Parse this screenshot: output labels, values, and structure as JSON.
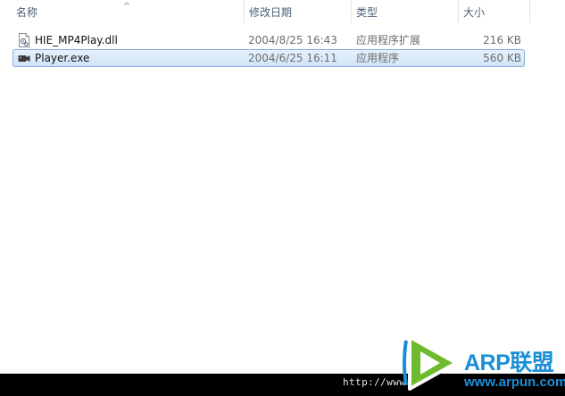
{
  "columns": [
    {
      "label": "名称"
    },
    {
      "label": "修改日期"
    },
    {
      "label": "类型"
    },
    {
      "label": "大小"
    }
  ],
  "files": [
    {
      "name": "HIE_MP4Play.dll",
      "date": "2004/8/25 16:43",
      "type": "应用程序扩展",
      "size": "216 KB",
      "icon": "dll-file-icon",
      "selected": false
    },
    {
      "name": "Player.exe",
      "date": "2004/6/25 16:11",
      "type": "应用程序",
      "size": "560 KB",
      "icon": "exe-file-icon",
      "selected": true
    }
  ],
  "status_bar": {
    "url_text": "http://www"
  },
  "watermark": {
    "brand": "ARP联盟",
    "url": "www.arpun.com"
  },
  "colors": {
    "selection_bg": "#cfe5f8",
    "selection_border": "#84acdd",
    "header_text": "#4c607a",
    "watermark_blue": "#1a8fd8",
    "watermark_green": "#6dbb2c"
  }
}
